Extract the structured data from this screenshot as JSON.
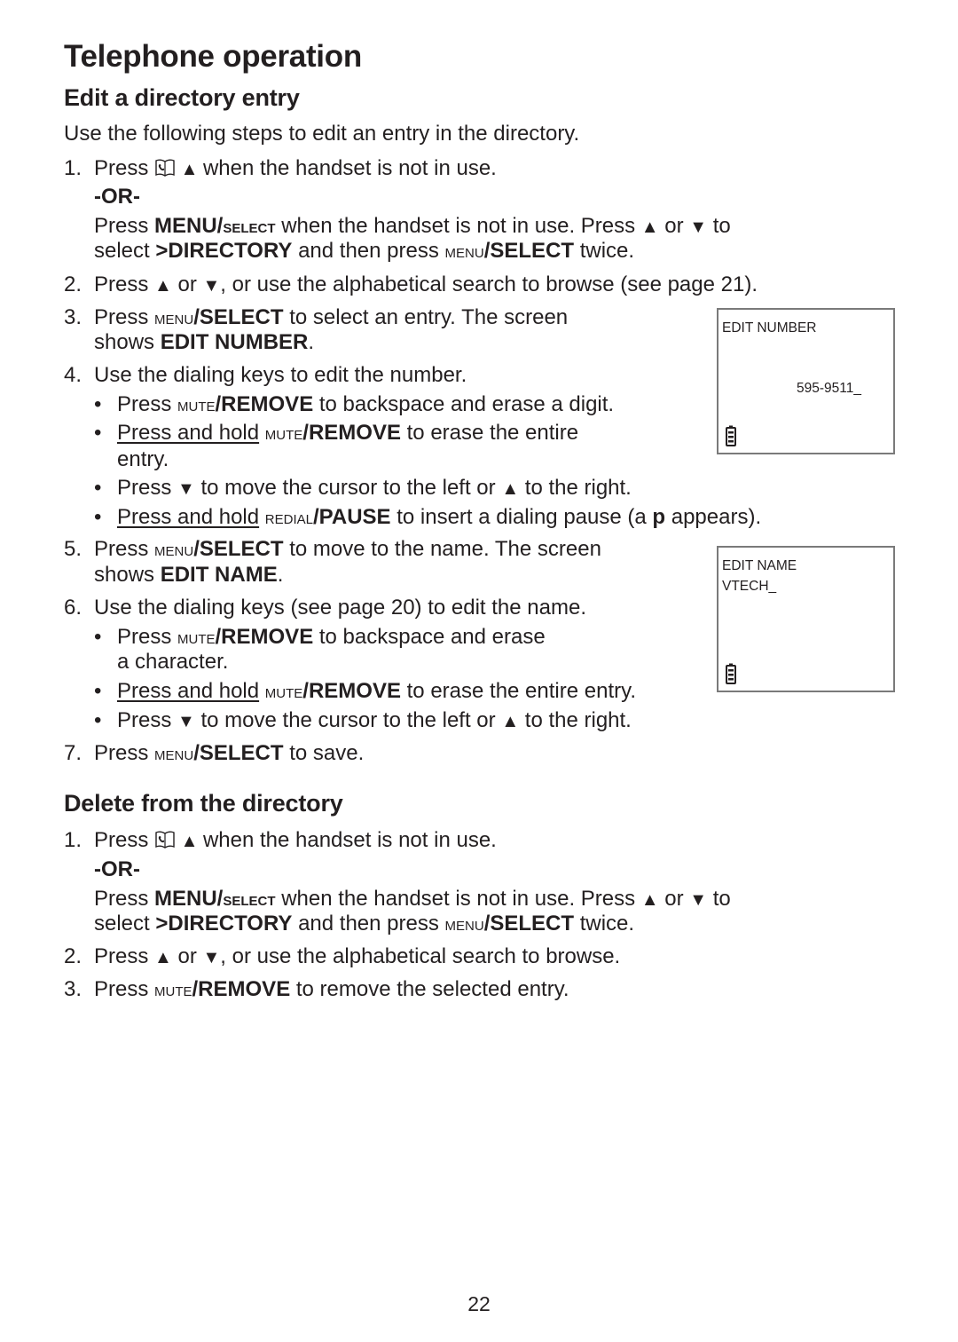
{
  "page_title": "Telephone operation",
  "sections": {
    "edit": {
      "title": "Edit a directory entry",
      "intro": "Use the following steps to edit an entry in the directory.",
      "lines": [
        {
          "kind": "num",
          "label": "1.",
          "runs": [
            {
              "t": "Press "
            },
            {
              "icon": "directory-icon"
            },
            {
              "t": " ▲ ",
              "sym": true
            },
            {
              "t": "when the handset is not in use."
            }
          ]
        },
        {
          "kind": "body",
          "runs": [
            {
              "t": "-OR-",
              "b": true
            }
          ]
        },
        {
          "kind": "body",
          "runs": [
            {
              "t": "Press "
            },
            {
              "t": "MENU/",
              "b": true
            },
            {
              "t": "select",
              "sc": true,
              "b": true
            },
            {
              "t": " when the handset is not in use. Press "
            },
            {
              "t": "▲",
              "sym": true
            },
            {
              "t": " or "
            },
            {
              "t": "▼",
              "sym": true
            },
            {
              "t": "  to"
            }
          ]
        },
        {
          "kind": "body",
          "runs": [
            {
              "t": "select "
            },
            {
              "t": ">DIRECTORY",
              "b": true
            },
            {
              "t": " and then press "
            },
            {
              "t": "menu",
              "sc": true
            },
            {
              "t": "/SELECT",
              "b": true
            },
            {
              "t": " twice."
            }
          ]
        },
        {
          "kind": "num",
          "label": "2.",
          "runs": [
            {
              "t": "Press "
            },
            {
              "t": "▲",
              "sym": true
            },
            {
              "t": " or "
            },
            {
              "t": "▼",
              "sym": true
            },
            {
              "t": ", or use the alphabetical search to browse (see page 21)."
            }
          ]
        },
        {
          "kind": "num",
          "label": "3.",
          "runs": [
            {
              "t": "Press "
            },
            {
              "t": "menu",
              "sc": true
            },
            {
              "t": "/SELECT",
              "b": true
            },
            {
              "t": " to select an entry. The screen"
            }
          ]
        },
        {
          "kind": "body",
          "runs": [
            {
              "t": "shows "
            },
            {
              "t": "EDIT NUMBER",
              "b": true
            },
            {
              "t": "."
            }
          ]
        },
        {
          "kind": "num",
          "label": "4.",
          "runs": [
            {
              "t": "Use the dialing keys to edit the number."
            }
          ]
        },
        {
          "kind": "bullet",
          "runs": [
            {
              "t": "Press "
            },
            {
              "t": "mute",
              "sc": true
            },
            {
              "t": "/REMOVE",
              "b": true
            },
            {
              "t": " to backspace and erase a digit."
            }
          ]
        },
        {
          "kind": "bullet",
          "runs": [
            {
              "t": "Press and hold",
              "u": true
            },
            {
              "t": " "
            },
            {
              "t": "mute",
              "sc": true
            },
            {
              "t": "/REMOVE",
              "b": true
            },
            {
              "t": " to erase the entire"
            }
          ]
        },
        {
          "kind": "bullet-cont",
          "runs": [
            {
              "t": "entry."
            }
          ]
        },
        {
          "kind": "bullet",
          "runs": [
            {
              "t": "Press "
            },
            {
              "t": "▼",
              "sym": true
            },
            {
              "t": " to move the cursor to the left or "
            },
            {
              "t": "▲",
              "sym": true
            },
            {
              "t": " to the right."
            }
          ]
        },
        {
          "kind": "bullet",
          "runs": [
            {
              "t": "Press and hold",
              "u": true
            },
            {
              "t": " "
            },
            {
              "t": "redial",
              "sc": true
            },
            {
              "t": "/PAUSE",
              "b": true
            },
            {
              "t": " to insert a dialing pause (a "
            },
            {
              "t": "p",
              "b": true
            },
            {
              "t": " appears)."
            }
          ]
        },
        {
          "kind": "num",
          "label": "5.",
          "runs": [
            {
              "t": "Press "
            },
            {
              "t": "menu",
              "sc": true
            },
            {
              "t": "/SELECT",
              "b": true
            },
            {
              "t": " to move to the name. The screen"
            }
          ]
        },
        {
          "kind": "body",
          "runs": [
            {
              "t": "shows "
            },
            {
              "t": "EDIT NAME",
              "b": true
            },
            {
              "t": "."
            }
          ]
        },
        {
          "kind": "num",
          "label": "6.",
          "runs": [
            {
              "t": "Use the dialing keys (see page 20) to edit the name."
            }
          ]
        },
        {
          "kind": "bullet",
          "runs": [
            {
              "t": "Press "
            },
            {
              "t": "mute",
              "sc": true
            },
            {
              "t": "/REMOVE",
              "b": true
            },
            {
              "t": " to backspace and erase"
            }
          ]
        },
        {
          "kind": "bullet-cont",
          "runs": [
            {
              "t": "a character."
            }
          ]
        },
        {
          "kind": "bullet",
          "runs": [
            {
              "t": "Press and hold",
              "u": true
            },
            {
              "t": " "
            },
            {
              "t": "mute",
              "sc": true
            },
            {
              "t": "/REMOVE",
              "b": true
            },
            {
              "t": " to erase the entire entry."
            }
          ]
        },
        {
          "kind": "bullet",
          "runs": [
            {
              "t": "Press "
            },
            {
              "t": "▼",
              "sym": true
            },
            {
              "t": " to move the cursor to the left or "
            },
            {
              "t": "▲",
              "sym": true
            },
            {
              "t": " to the right."
            }
          ]
        },
        {
          "kind": "num",
          "label": "7.",
          "runs": [
            {
              "t": "Press "
            },
            {
              "t": "menu",
              "sc": true
            },
            {
              "t": "/SELECT",
              "b": true
            },
            {
              "t": " to save."
            }
          ]
        }
      ]
    },
    "delete": {
      "title": "Delete from the directory",
      "lines": [
        {
          "kind": "num",
          "label": "1.",
          "runs": [
            {
              "t": "Press "
            },
            {
              "icon": "directory-icon"
            },
            {
              "t": " ▲ ",
              "sym": true
            },
            {
              "t": "when the handset is not in use."
            }
          ]
        },
        {
          "kind": "body",
          "runs": [
            {
              "t": "-OR-",
              "b": true
            }
          ]
        },
        {
          "kind": "body",
          "runs": [
            {
              "t": "Press "
            },
            {
              "t": "MENU/",
              "b": true
            },
            {
              "t": "select",
              "sc": true,
              "b": true
            },
            {
              "t": " when the handset is not in use. Press "
            },
            {
              "t": "▲",
              "sym": true
            },
            {
              "t": " or "
            },
            {
              "t": "▼",
              "sym": true
            },
            {
              "t": "  to"
            }
          ]
        },
        {
          "kind": "body",
          "runs": [
            {
              "t": "select "
            },
            {
              "t": ">DIRECTORY",
              "b": true
            },
            {
              "t": " and then press "
            },
            {
              "t": "menu",
              "sc": true
            },
            {
              "t": "/SELECT",
              "b": true
            },
            {
              "t": " twice."
            }
          ]
        },
        {
          "kind": "num",
          "label": "2.",
          "runs": [
            {
              "t": "Press "
            },
            {
              "t": "▲",
              "sym": true
            },
            {
              "t": " or "
            },
            {
              "t": "▼",
              "sym": true
            },
            {
              "t": ", or use the alphabetical search to browse."
            }
          ]
        },
        {
          "kind": "num",
          "label": "3.",
          "runs": [
            {
              "t": "Press "
            },
            {
              "t": "mute",
              "sc": true
            },
            {
              "t": "/REMOVE",
              "b": true
            },
            {
              "t": " to remove the selected entry."
            }
          ]
        }
      ]
    }
  },
  "screens": {
    "edit_number": {
      "line1": "EDIT NUMBER",
      "value": "595-9511_",
      "icon": "battery-icon"
    },
    "edit_name": {
      "line1": "EDIT NAME",
      "line2": "VTECH_",
      "icon": "battery-icon"
    }
  },
  "page_number": "22"
}
